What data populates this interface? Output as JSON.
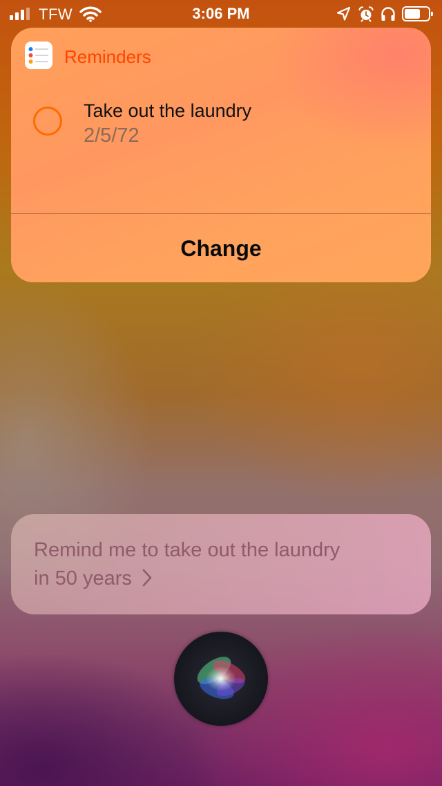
{
  "status_bar": {
    "carrier": "TFW",
    "time": "3:06 PM",
    "icons": [
      "signal-icon",
      "wifi-icon",
      "location-arrow-icon",
      "alarm-icon",
      "headphones-icon",
      "battery-icon"
    ]
  },
  "reminders_card": {
    "app_name": "Reminders",
    "app_icon": "reminders-app-icon",
    "accent_color": "#ff4400",
    "reminder": {
      "title": "Take out the laundry",
      "date": "2/5/72"
    },
    "change_label": "Change"
  },
  "siri": {
    "utterance_line1": "Remind me to take out the laundry",
    "utterance_line2": "in 50 years",
    "chevron_icon": "chevron-right-icon",
    "orb_icon": "siri-orb-icon"
  }
}
